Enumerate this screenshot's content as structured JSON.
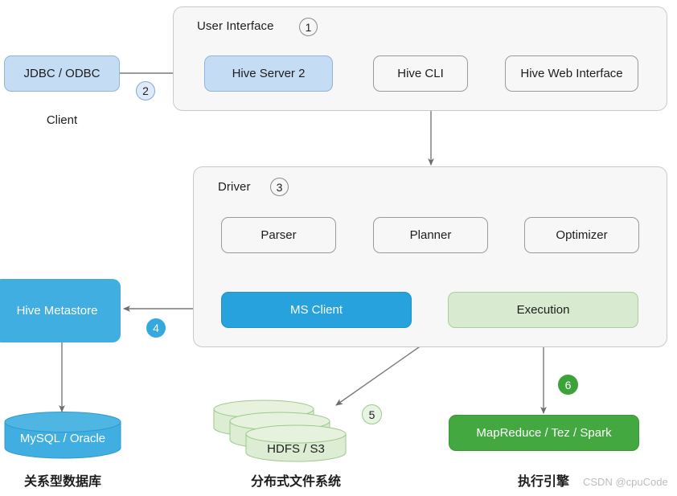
{
  "diagram": {
    "title_watermark": "CSDN @cpuCode",
    "colors": {
      "blue_solid": "#28a2dd",
      "blue_light": "#c5dcf5",
      "metastore_blue": "#40aee0",
      "green_solid": "#43a83f",
      "green_light": "#d8ead0",
      "group_bg": "#f7f7f7",
      "line": "#7a7a7a"
    },
    "groups": [
      {
        "title": "User Interface",
        "badge": "1"
      },
      {
        "title": "Driver",
        "badge": "3"
      }
    ],
    "client": {
      "node_label": "JDBC / ODBC",
      "caption": "Client",
      "badge": "2"
    },
    "ui_nodes": [
      {
        "label": "Hive Server 2"
      },
      {
        "label": "Hive CLI"
      },
      {
        "label": "Hive Web Interface"
      }
    ],
    "driver_nodes": [
      {
        "label": "Parser"
      },
      {
        "label": "Planner"
      },
      {
        "label": "Optimizer"
      },
      {
        "label": "MS Client"
      },
      {
        "label": "Execution"
      }
    ],
    "metastore": {
      "label": "Hive Metastore",
      "badge": "4"
    },
    "rdbms": {
      "label": "MySQL / Oracle",
      "caption": "关系型数据库"
    },
    "filesystem": {
      "label": "HDFS / S3",
      "caption": "分布式文件系统",
      "badge": "5"
    },
    "engine": {
      "label": "MapReduce / Tez / Spark",
      "caption": "执行引擎",
      "badge": "6"
    }
  }
}
